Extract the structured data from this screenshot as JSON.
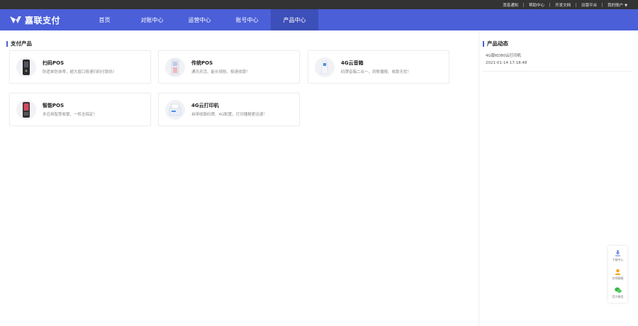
{
  "topbar": {
    "links": [
      "消息通知",
      "帮助中心",
      "开发文档",
      "旧版平台",
      "我的账户"
    ]
  },
  "brand": {
    "name": "嘉联支付",
    "color": "#4a5fd8"
  },
  "nav": {
    "items": [
      "首页",
      "对账中心",
      "运营中心",
      "账号中心",
      "产品中心"
    ],
    "active_index": 4
  },
  "products": {
    "section_title": "支付产品",
    "items": [
      {
        "title": "扫码POS",
        "desc": "防遗单防抹零，超大窗口极速扫码付款码！",
        "icon": "scan-pos-device-icon"
      },
      {
        "title": "传统POS",
        "desc": "通讯灵活、能长续航、极速收银！",
        "icon": "traditional-pos-device-icon"
      },
      {
        "title": "4G云音箱",
        "desc": "码牌音箱二合一，到账播报、收款无忧！",
        "icon": "cloud-speaker-device-icon"
      },
      {
        "title": "智能POS",
        "desc": "多应用智慧收银、一机全搞定！",
        "icon": "smart-pos-device-icon"
      },
      {
        "title": "4G云打印机",
        "desc": "自带收款码牌、4G配置，打印播报更迅速！",
        "icon": "cloud-printer-device-icon"
      }
    ]
  },
  "news": {
    "section_title": "产品动态",
    "items": [
      {
        "title": "4G版KD80云打印机",
        "date": "2021-01-14 17:18:48"
      }
    ]
  },
  "float_panel": {
    "items": [
      {
        "label": "下载中心",
        "icon": "download-icon"
      },
      {
        "label": "在线客服",
        "icon": "customer-service-icon"
      },
      {
        "label": "官方微信",
        "icon": "wechat-icon"
      }
    ]
  }
}
